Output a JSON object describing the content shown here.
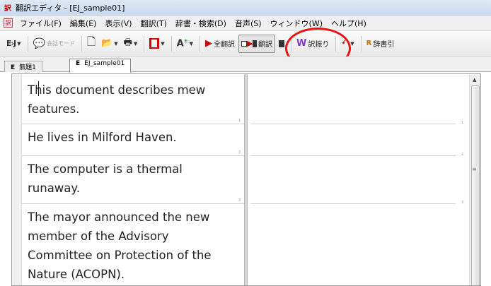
{
  "window": {
    "title": "翻訳エディタ - [EJ_sample01]",
    "app_icon_glyph": "訳"
  },
  "menu": [
    "ファイル(F)",
    "編集(E)",
    "表示(V)",
    "翻訳(T)",
    "辞書・検索(D)",
    "音声(S)",
    "ウィンドウ(W)",
    "ヘルプ(H)"
  ],
  "toolbar": {
    "direction": "E›J",
    "conversation_mode": "会話モード",
    "translate_all": "全翻訳",
    "translate": "翻訳",
    "word_translation": "訳振り",
    "dictionary": "辞書引"
  },
  "tabs": [
    {
      "prefix": "E",
      "label": "無題1"
    },
    {
      "prefix": "E",
      "label": "EJ_sample01"
    }
  ],
  "segments": [
    {
      "lines": [
        "This document describes mew",
        "features."
      ],
      "number": "1"
    },
    {
      "lines": [
        "He lives in Milford Haven."
      ],
      "number": "2"
    },
    {
      "lines": [
        "The computer is a thermal",
        "runaway."
      ],
      "number": "3"
    },
    {
      "lines": [
        "The mayor announced the new",
        "member of the Advisory",
        "Committee on Protection of the",
        "Nature (ACOPN)."
      ],
      "number": ""
    }
  ],
  "colors": {
    "highlight": "#e11111",
    "play": "#d10000"
  }
}
